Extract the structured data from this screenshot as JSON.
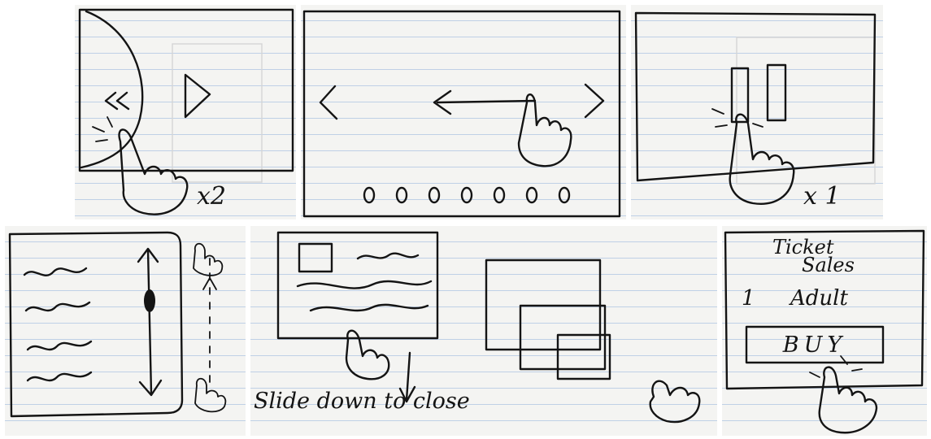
{
  "panels": [
    {
      "id": "double-tap-play",
      "multiplier": "x2"
    },
    {
      "id": "swipe-carousel",
      "dots": 7
    },
    {
      "id": "single-tap-pause",
      "multiplier": "x 1"
    },
    {
      "id": "vertical-scroll"
    },
    {
      "id": "slide-down-close",
      "caption": "Slide down to close"
    },
    {
      "id": "ticket-sales",
      "title_line1": "Ticket",
      "title_line2": "Sales",
      "quantity": "1",
      "ticket_type": "Adult",
      "button_label": "BUY"
    }
  ],
  "colors": {
    "ink": "#141414",
    "paper": "#f4f4f2",
    "ruled_line": "#bfd0e6"
  }
}
